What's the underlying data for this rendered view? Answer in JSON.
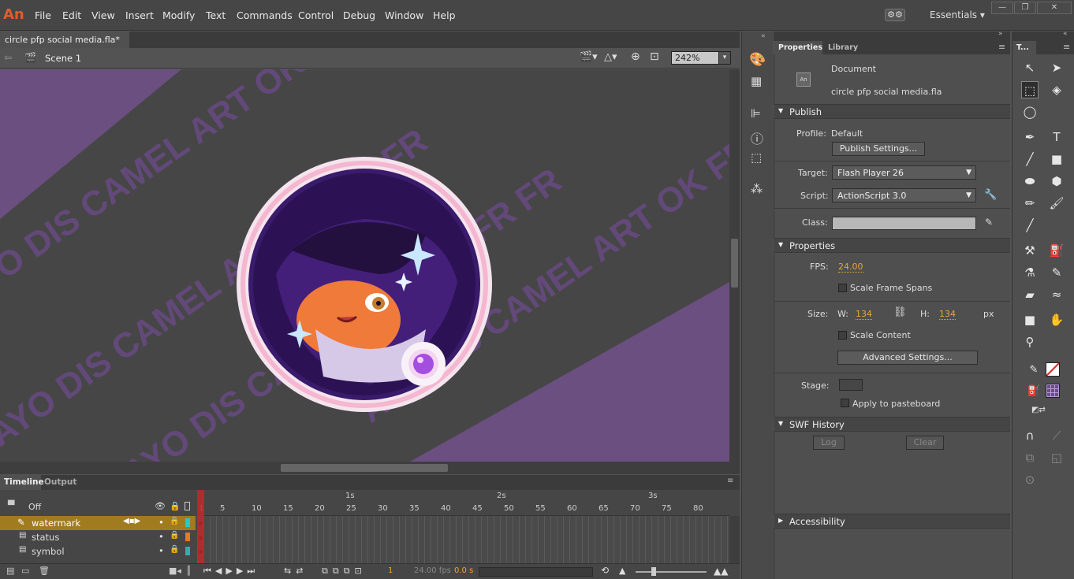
{
  "app": {
    "logo": "An"
  },
  "menu": [
    "File",
    "Edit",
    "View",
    "Insert",
    "Modify",
    "Text",
    "Commands",
    "Control",
    "Debug",
    "Window",
    "Help"
  ],
  "workspace": "Essentials",
  "document_tab": "circle pfp social media.fla*",
  "scene": "Scene 1",
  "zoom": "242%",
  "watermark_text": "AYO DIS CAMEL ART OK FR FR",
  "panel_tabs": {
    "timeline": "Timeline",
    "output": "Output"
  },
  "timeline": {
    "off_label": "Off",
    "ruler_seconds": [
      "1s",
      "2s",
      "3s"
    ],
    "ruler_frames": [
      "1",
      "5",
      "10",
      "15",
      "20",
      "25",
      "30",
      "35",
      "40",
      "45",
      "50",
      "55",
      "60",
      "65",
      "70",
      "75",
      "80"
    ],
    "layers": [
      {
        "name": "watermark",
        "color": "#29c8c8",
        "active": true
      },
      {
        "name": "status",
        "color": "#e67a1c",
        "active": false
      },
      {
        "name": "symbol",
        "color": "#29b3a8",
        "active": false
      }
    ],
    "current_frame": "1",
    "fps": "24.00 fps",
    "time": "0.0 s"
  },
  "properties": {
    "tabs": {
      "properties": "Properties",
      "library": "Library"
    },
    "doc_type": "Document",
    "doc_name": "circle pfp social media.fla",
    "publish": {
      "header": "Publish",
      "profile_label": "Profile:",
      "profile_value": "Default",
      "publish_settings": "Publish Settings...",
      "target_label": "Target:",
      "target_value": "Flash Player 26",
      "script_label": "Script:",
      "script_value": "ActionScript 3.0",
      "class_label": "Class:"
    },
    "props": {
      "header": "Properties",
      "fps_label": "FPS:",
      "fps_value": "24.00",
      "scale_spans": "Scale Frame Spans",
      "size_label": "Size:",
      "w_label": "W:",
      "w_value": "134",
      "h_label": "H:",
      "h_value": "134",
      "unit": "px",
      "scale_content": "Scale Content",
      "advanced": "Advanced Settings...",
      "stage_label": "Stage:",
      "apply_pasteboard": "Apply to pasteboard"
    },
    "swf": {
      "header": "SWF History",
      "log": "Log",
      "clear": "Clear"
    },
    "accessibility": "Accessibility"
  },
  "tools_title": "T...",
  "colors": {
    "stage_bg": "#464646",
    "band": "#6a4f80",
    "watermark_text": "#654a7d",
    "accent": "#e45b2d",
    "active_layer": "#a07b20",
    "playhead": "#c0282d"
  }
}
